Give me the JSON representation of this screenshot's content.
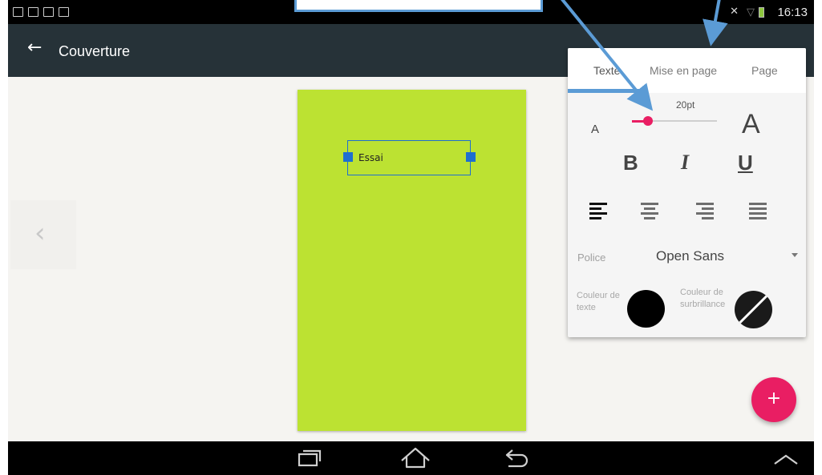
{
  "status_bar": {
    "time": "16:13"
  },
  "app_bar": {
    "back_icon": "arrow-left-icon",
    "title": "Couverture"
  },
  "canvas": {
    "background_color": "#bce232",
    "text_box": {
      "text": "Essai"
    }
  },
  "format_panel": {
    "tabs": [
      {
        "label": "Texte",
        "selected": true
      },
      {
        "label": "Mise en page",
        "selected": false
      },
      {
        "label": "Page",
        "selected": false
      }
    ],
    "font_size": {
      "value_label": "20pt",
      "small_a": "A",
      "big_a": "A",
      "slider_fraction": 0.19
    },
    "styles": {
      "bold": "B",
      "italic": "I",
      "underline": "U"
    },
    "alignment": {
      "options": [
        "align-left",
        "align-center",
        "align-right",
        "align-justify"
      ],
      "selected": "align-left"
    },
    "font": {
      "label": "Police",
      "value": "Open Sans"
    },
    "colors": {
      "text_color_label": "Couleur de texte",
      "text_color": "#000000",
      "highlight_label": "Couleur de surbrillance",
      "highlight_color": "none"
    }
  },
  "fab": {
    "label": "+"
  },
  "theme": {
    "app_bar": "#263238",
    "accent": "#e91e63",
    "annotation": "#5b9bd5"
  }
}
